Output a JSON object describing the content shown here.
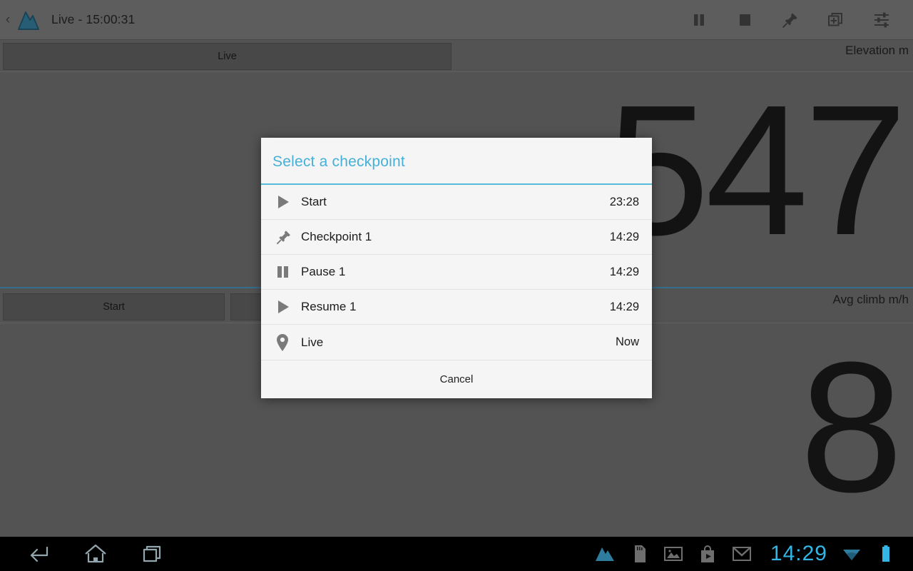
{
  "app": {
    "title": "Live - 15:00:31",
    "logo_icon": "mountain-icon",
    "back_icon": "chevron-left-icon",
    "action_icons": [
      {
        "name": "pause-icon",
        "label": "Pause"
      },
      {
        "name": "stop-icon",
        "label": "Stop"
      },
      {
        "name": "pin-icon",
        "label": "Add checkpoint"
      },
      {
        "name": "add-layer-icon",
        "label": "New segment"
      },
      {
        "name": "sliders-icon",
        "label": "Settings"
      }
    ]
  },
  "tabs": {
    "active_label": "Live"
  },
  "metrics": [
    {
      "label": "Elevation m",
      "value": "547"
    },
    {
      "label": "Avg climb m/h",
      "value": "8"
    }
  ],
  "buttons": {
    "start_label": "Start",
    "second_label": ""
  },
  "dialog": {
    "title": "Select a checkpoint",
    "rows": [
      {
        "icon": "play-icon",
        "label": "Start",
        "time": "23:28"
      },
      {
        "icon": "pin-icon",
        "label": "Checkpoint 1",
        "time": "14:29"
      },
      {
        "icon": "pause-icon",
        "label": "Pause 1",
        "time": "14:29"
      },
      {
        "icon": "play-icon",
        "label": "Resume 1",
        "time": "14:29"
      },
      {
        "icon": "marker-icon",
        "label": "Live",
        "time": "Now"
      }
    ],
    "cancel_label": "Cancel",
    "accent_color": "#45b0d8"
  },
  "navbar": {
    "buttons": [
      {
        "name": "back-icon",
        "label": "Back"
      },
      {
        "name": "home-icon",
        "label": "Home"
      },
      {
        "name": "recents-icon",
        "label": "Recent apps"
      }
    ],
    "tray": [
      {
        "name": "mountain-app-icon",
        "label": "Tracker running"
      },
      {
        "name": "sdcard-icon",
        "label": "SD card"
      },
      {
        "name": "gallery-icon",
        "label": "Screenshot saved"
      },
      {
        "name": "play-store-icon",
        "label": "Play Store"
      },
      {
        "name": "gmail-icon",
        "label": "Gmail"
      }
    ],
    "clock": "14:29",
    "wifi_icon": "wifi-icon",
    "battery_icon": "battery-icon",
    "accent_color": "#33b5e5"
  }
}
